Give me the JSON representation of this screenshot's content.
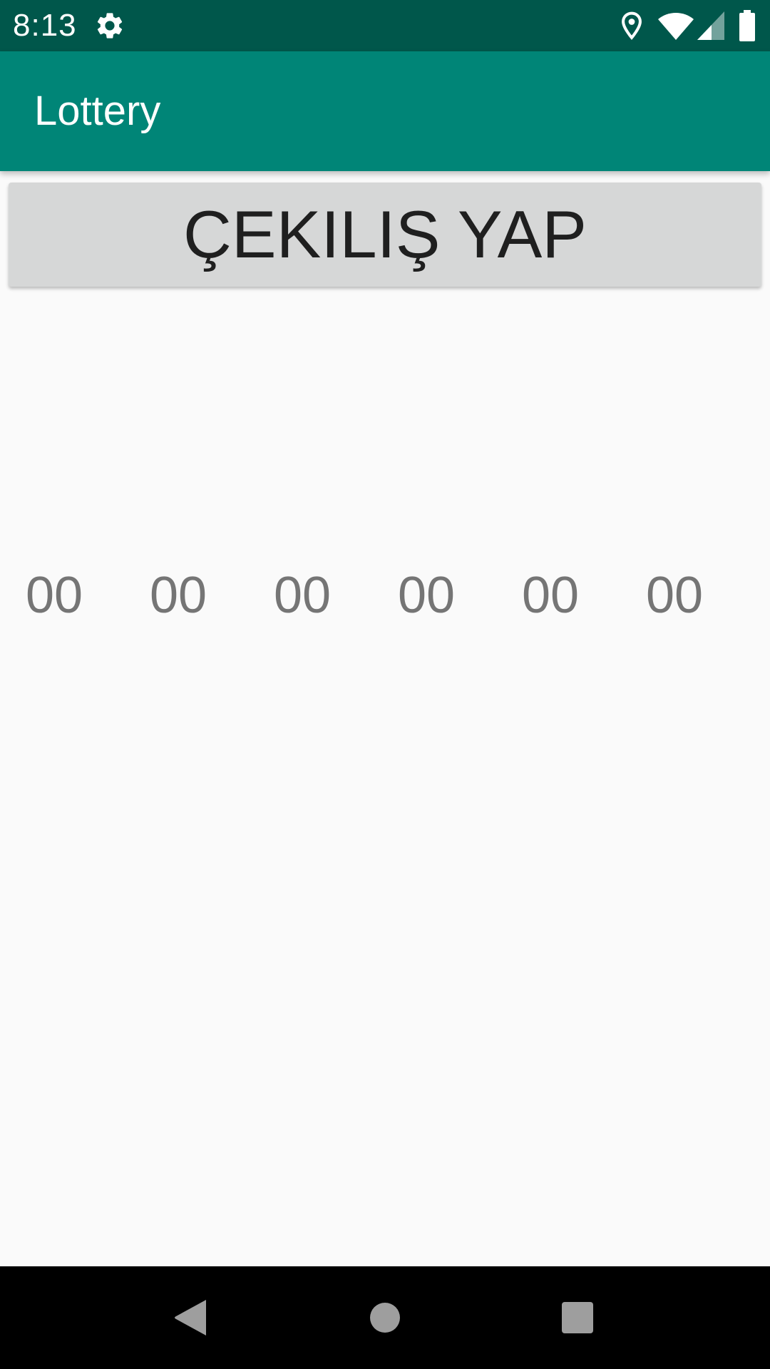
{
  "status_bar": {
    "time": "8:13",
    "icons": [
      "settings-gear-icon",
      "location-pin-icon",
      "wifi-icon",
      "cell-signal-icon",
      "battery-icon"
    ]
  },
  "app_bar": {
    "title": "Lottery"
  },
  "draw_button": {
    "label": "ÇEKILIŞ YAP"
  },
  "lottery_numbers": [
    "00",
    "00",
    "00",
    "00",
    "00",
    "00"
  ],
  "nav_bar": {
    "icons": [
      "back-icon",
      "home-icon",
      "recents-icon"
    ]
  },
  "colors": {
    "status_bar": "#00574b",
    "app_bar": "#008577",
    "button_bg": "#d6d7d7",
    "number_text": "#757575",
    "background": "#fafafa"
  }
}
